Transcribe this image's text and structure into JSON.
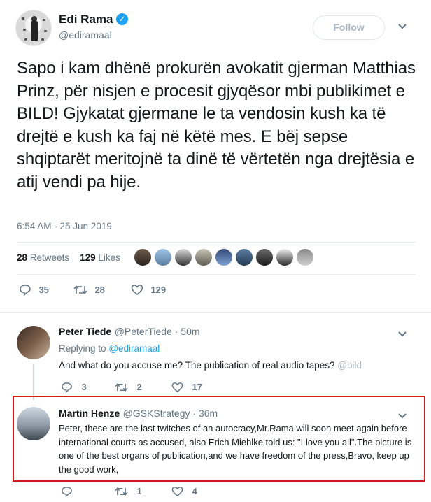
{
  "colors": {
    "accent": "#1da1f2",
    "muted": "#657786",
    "highlight_border": "#d61a1a"
  },
  "main_tweet": {
    "author_name": "Edi Rama",
    "handle": "@ediramaal",
    "follow_label": "Follow",
    "chevron": "⌄",
    "text": "Sapo i kam dhënë prokurën avokatit gjerman Matthias Prinz, për nisjen e procesit gjyqësor mbi publikimet e BILD! Gjykatat gjermane le ta vendosin kush ka të drejtë e kush ka faj në këtë mes. E bëj sepse shqiptarët meritojnë ta dinë të vërtetën nga drejtësia e atij vendi pa hije.",
    "timestamp": "6:54 AM - 25 Jun 2019",
    "retweets_count": "28",
    "retweets_label": "Retweets",
    "likes_count": "129",
    "likes_label": "Likes",
    "actions": {
      "replies": "35",
      "retweets": "28",
      "likes": "129"
    }
  },
  "icons": {
    "reply": "reply-icon",
    "retweet": "retweet-icon",
    "like": "heart-icon",
    "verified": "verified-badge-icon",
    "chevron": "chevron-down-icon"
  },
  "replies": [
    {
      "author_name": "Peter Tiede",
      "handle_time": "@PeterTiede · 50m",
      "replying_label": "Replying to",
      "replying_to": "@ediramaal",
      "text": "And what do you accuse me?  The publication of real audio tapes?",
      "mention": "@bild",
      "actions": {
        "replies": "3",
        "retweets": "2",
        "likes": "17"
      }
    },
    {
      "author_name": "Martin Henze",
      "handle_time": "@GSKStrategy · 36m",
      "text": "Peter, these are the last twitches of an autocracy,Mr.Rama will soon meet again before international courts as accused, also Erich Miehlke told us: \"I love you all\".The picture is one of the best organs of publication,and we have freedom of the press,Bravo, keep up the good work,",
      "actions": {
        "replies": "",
        "retweets": "1",
        "likes": "4"
      }
    }
  ]
}
